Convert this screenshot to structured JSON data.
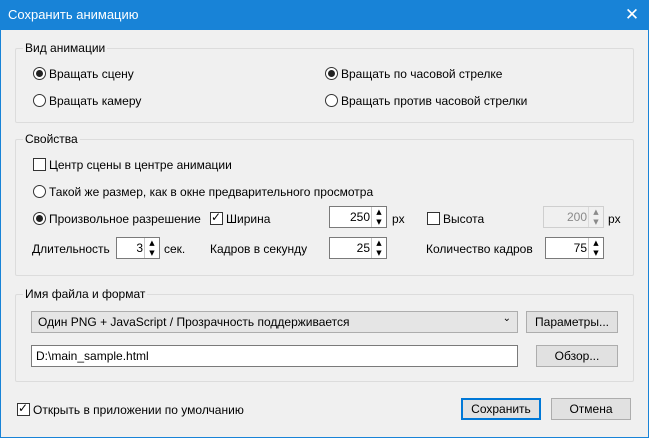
{
  "window": {
    "title": "Сохранить анимацию",
    "close_glyph": "✕"
  },
  "animation_group": {
    "label": "Вид анимации",
    "rotate_scene": "Вращать сцену",
    "rotate_camera": "Вращать камеру",
    "clockwise": "Вращать по часовой стрелке",
    "counterclockwise": "Вращать против часовой стрелки",
    "selected_mode": "rotate_scene",
    "selected_direction": "clockwise"
  },
  "properties_group": {
    "label": "Свойства",
    "center_scene": "Центр сцены в центре анимации",
    "center_scene_checked": false,
    "same_size": "Такой же размер, как в окне предварительного просмотра",
    "custom_resolution": "Произвольное разрешение",
    "width_label": "Ширина",
    "width_checked": true,
    "width_value": "250",
    "width_unit": "px",
    "height_label": "Высота",
    "height_checked": false,
    "height_value": "200",
    "height_unit": "px",
    "duration_label": "Длительность",
    "duration_value": "3",
    "duration_unit": "сек.",
    "fps_label": "Кадров в секунду",
    "fps_value": "25",
    "frames_label": "Количество кадров",
    "frames_value": "75"
  },
  "file_group": {
    "label": "Имя файла и формат",
    "format_value": "Один PNG + JavaScript / Прозрачность поддерживается",
    "params_button": "Параметры...",
    "path_value": "D:\\main_sample.html",
    "browse_button": "Обзор..."
  },
  "footer": {
    "open_default": "Открыть в приложении по умолчанию",
    "open_default_checked": true,
    "save_button": "Сохранить",
    "cancel_button": "Отмена"
  },
  "colors": {
    "titlebar": "#1883d7",
    "accent": "#0078d7"
  },
  "icons": {
    "spin_up": "▲",
    "spin_down": "▼",
    "dropdown": "⌄"
  }
}
